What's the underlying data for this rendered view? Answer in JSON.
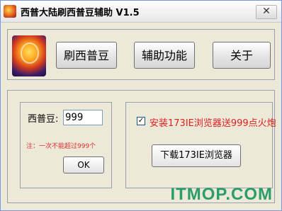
{
  "window": {
    "title": "西普大陆刷西普豆辅助  V1.5",
    "close_glyph": "✕"
  },
  "toolbar": {
    "brush_button": "刷西普豆",
    "assist_button": "辅助功能",
    "about_button": "关于"
  },
  "left_group": {
    "field_label": "西普豆:",
    "field_value": "999",
    "note": "注：一次不能超过999个",
    "ok_button": "OK"
  },
  "right_group": {
    "checkbox_checked": true,
    "checkbox_label": "安装173IE浏览器送999点火炮",
    "download_button": "下载173IE浏览器"
  },
  "watermark": "ITMOP.COM",
  "colors": {
    "note_red": "#e03030",
    "watermark_green": "#2b9d6a"
  }
}
